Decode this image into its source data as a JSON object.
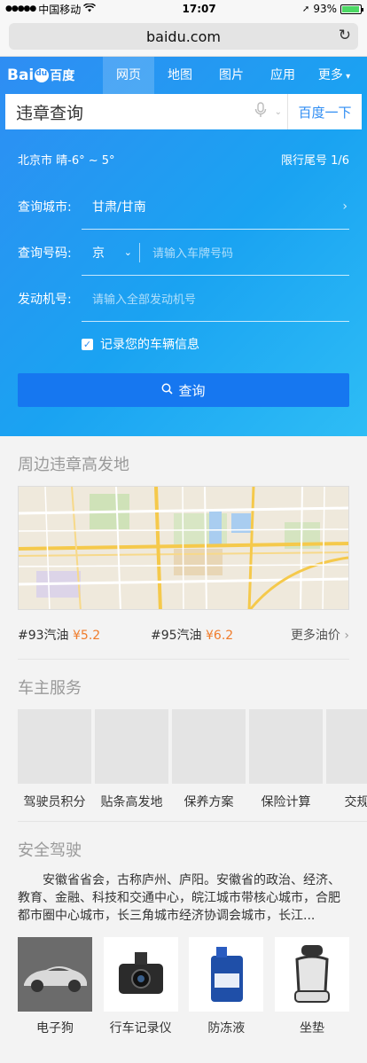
{
  "status_bar": {
    "carrier": "中国移动",
    "time": "17:07",
    "battery": "93%",
    "battery_level": 0.93
  },
  "browser": {
    "url": "baidu.com"
  },
  "nav": {
    "logo": "Bai百度",
    "items": [
      {
        "label": "网页",
        "active": true
      },
      {
        "label": "地图"
      },
      {
        "label": "图片"
      },
      {
        "label": "应用"
      },
      {
        "label": "更多"
      }
    ]
  },
  "search": {
    "query": "违章查询",
    "button": "百度一下"
  },
  "weather": {
    "text": "北京市  晴-6° ~ 5°",
    "restriction": "限行尾号 1/6"
  },
  "form": {
    "city_label": "查询城市:",
    "city_value": "甘肃/甘南",
    "plate_label": "查询号码:",
    "plate_province": "京",
    "plate_placeholder": "请输入车牌号码",
    "engine_label": "发动机号:",
    "engine_placeholder": "请输入全部发动机号",
    "remember": "记录您的车辆信息",
    "submit": "查询"
  },
  "violations": {
    "title": "周边违章高发地"
  },
  "oil": {
    "items": [
      {
        "name": "#93汽油",
        "price": "¥5.2"
      },
      {
        "name": "#95汽油",
        "price": "¥6.2"
      }
    ],
    "more": "更多油价"
  },
  "services": {
    "title": "车主服务",
    "items": [
      "驾驶员积分",
      "贴条高发地",
      "保养方案",
      "保险计算",
      "交规分"
    ]
  },
  "safety": {
    "title": "安全驾驶",
    "article": "安徽省省会，古称庐州、庐阳。安徽省的政治、经济、教育、金融、科技和交通中心，皖江城市带核心城市，合肥都市圈中心城市，长三角城市经济协调会城市，长江...",
    "products": [
      "电子狗",
      "行车记录仪",
      "防冻液",
      "坐垫"
    ]
  },
  "colors": {
    "brand_blue": "#2f8df3",
    "button_blue": "#1677f0",
    "price_orange": "#f07c2b"
  }
}
